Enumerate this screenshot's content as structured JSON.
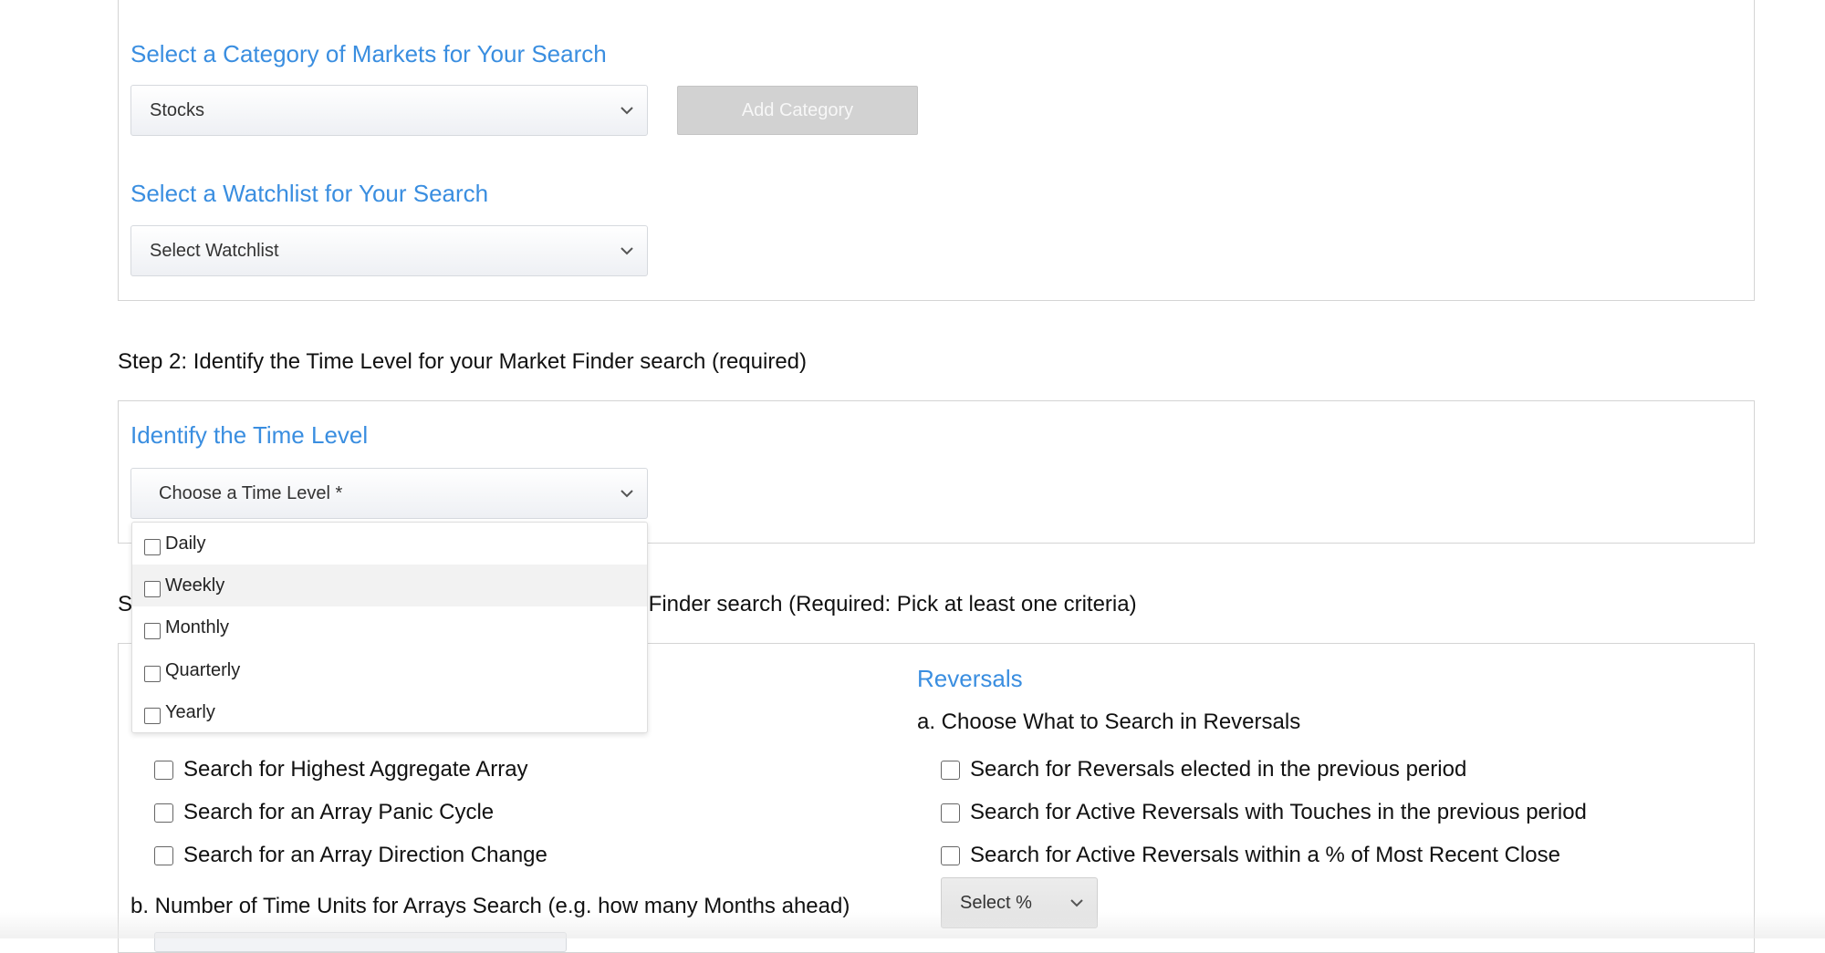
{
  "step1": {
    "category_title": "Select a Category of Markets for Your Search",
    "category_select_value": "Stocks",
    "add_category_label": "Add Category",
    "watchlist_title": "Select a Watchlist for Your Search",
    "watchlist_select_value": "Select Watchlist"
  },
  "step2": {
    "step_label": "Step 2:",
    "step_text": "Identify the Time Level for your Market Finder search (required)",
    "title": "Identify the Time Level",
    "time_level_select_value": "Choose a Time Level *",
    "dropdown_options": [
      "Daily",
      "Weekly",
      "Monthly",
      "Quarterly",
      "Yearly"
    ],
    "hovered_option": "Weekly"
  },
  "step3": {
    "step_prefix": "S",
    "step_text_visible": "et Finder search (Required: Pick at least one criteria)",
    "arrays_options": [
      "Search for Highest Aggregate Array",
      "Search for an Array Panic Cycle",
      "Search for an Array Direction Change"
    ],
    "arrays_b_label": "b.  Number of Time Units for Arrays Search (e.g. how many Months ahead)",
    "reversals_title": "Reversals",
    "reversals_a_label": "a.  Choose What to Search in Reversals",
    "reversals_options": [
      "Search for Reversals elected in the previous period",
      "Search for Active Reversals with Touches in the previous period",
      "Search for Active Reversals within a % of Most Recent Close"
    ],
    "percent_select_value": "Select %"
  },
  "colors": {
    "accent_blue": "#3a8ee0",
    "disabled_button": "#d2d2d2",
    "border": "#d4d4d4"
  }
}
